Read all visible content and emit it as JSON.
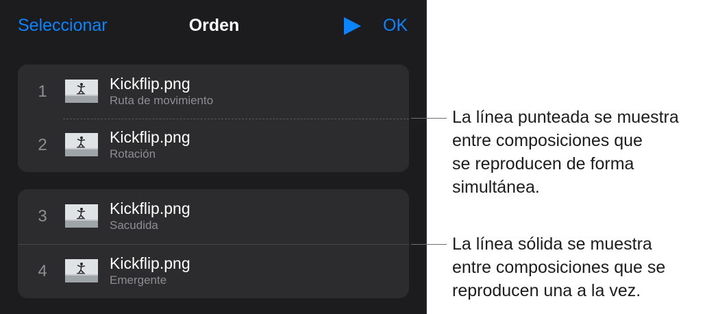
{
  "header": {
    "select_label": "Seleccionar",
    "title": "Orden",
    "play_icon": "play-icon",
    "ok_label": "OK"
  },
  "accent_color": "#0a84ff",
  "groups": [
    {
      "separator": "dotted",
      "rows": [
        {
          "number": "1",
          "name": "Kickflip.png",
          "effect": "Ruta de movimiento"
        },
        {
          "number": "2",
          "name": "Kickflip.png",
          "effect": "Rotación"
        }
      ]
    },
    {
      "separator": "solid",
      "rows": [
        {
          "number": "3",
          "name": "Kickflip.png",
          "effect": "Sacudida"
        },
        {
          "number": "4",
          "name": "Kickflip.png",
          "effect": "Emergente"
        }
      ]
    }
  ],
  "callouts": {
    "dotted": "La línea punteada se muestra\nentre composiciones que\nse reproducen de forma\nsimultánea.",
    "solid": "La línea sólida se muestra\nentre composiciones que se\nreproducen una a la vez."
  }
}
